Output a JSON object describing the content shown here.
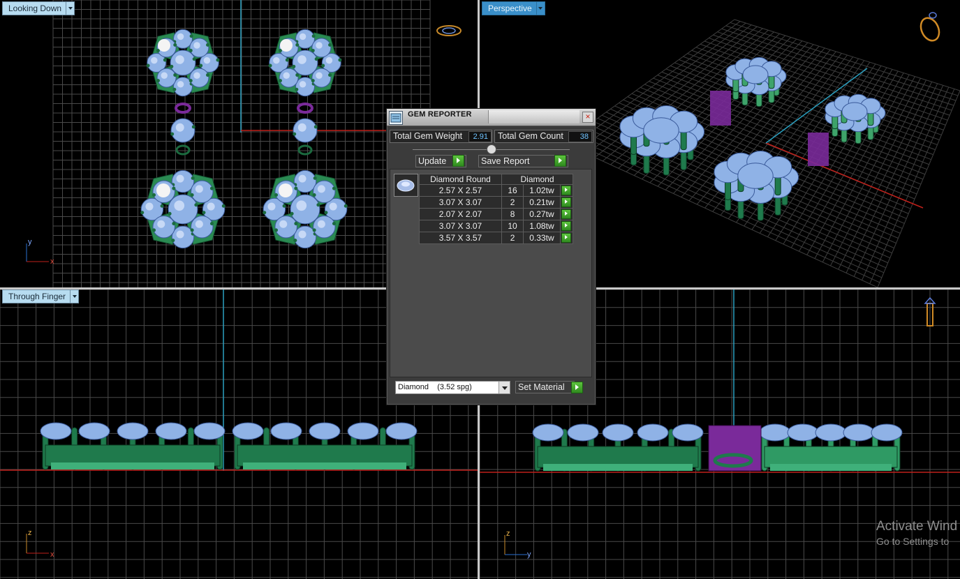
{
  "viewports": {
    "top_left": {
      "label": "Looking Down",
      "axis_a": "y",
      "axis_b": "x"
    },
    "top_right": {
      "label": "Perspective"
    },
    "bottom_left": {
      "label": "Through Finger",
      "axis_a": "z",
      "axis_b": "x"
    },
    "bottom_right": {
      "axis_a": "z",
      "axis_b": "y"
    }
  },
  "gem_reporter": {
    "title": "GEM REPORTER",
    "close_glyph": "×",
    "total_weight_label": "Total Gem Weight",
    "total_weight_value": "2.91",
    "total_count_label": "Total Gem Count",
    "total_count_value": "38",
    "update_label": "Update",
    "save_report_label": "Save Report",
    "table_headers": [
      "Diamond Round",
      "Diamond"
    ],
    "rows": [
      {
        "size": "2.57 X 2.57",
        "count": "16",
        "weight": "1.02tw"
      },
      {
        "size": "3.07 X 3.07",
        "count": "2",
        "weight": "0.21tw"
      },
      {
        "size": "2.07 X 2.07",
        "count": "8",
        "weight": "0.27tw"
      },
      {
        "size": "3.07 X 3.07",
        "count": "10",
        "weight": "1.08tw"
      },
      {
        "size": "3.57 X 3.57",
        "count": "2",
        "weight": "0.33tw"
      }
    ],
    "material_select": "Diamond    (3.52 spg)",
    "set_material_label": "Set Material"
  },
  "watermark": {
    "line1": "Activate Wind",
    "line2": "Go to Settings to"
  },
  "colors": {
    "grid": "#4a4a4a",
    "grid_major": "#6a6a6a",
    "axis_red": "#c0201a",
    "axis_cyan": "#2a9fbf",
    "gem": "#8fb2e6",
    "metal_green": "#1e7a4e",
    "metal_purple": "#7a2a9a"
  }
}
